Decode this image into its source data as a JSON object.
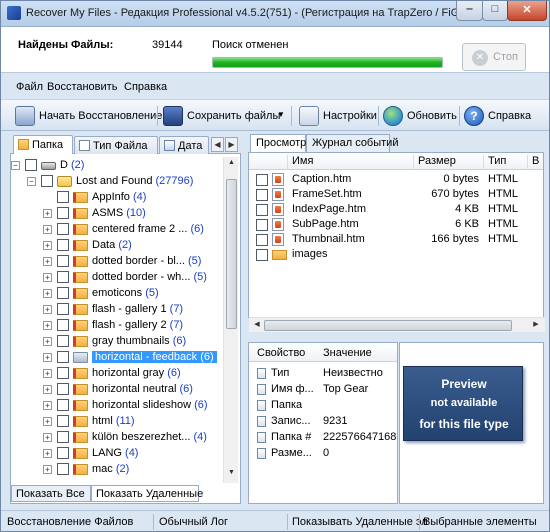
{
  "window": {
    "title": "Recover My Files - Редакция Professional v4.5.2(751)   -  (Регистрация на TrapZero / FiG...",
    "min_label": "‒",
    "max_label": "□",
    "close_label": "✕"
  },
  "status": {
    "found_label": "Найдены Файлы:",
    "found_value": "39144",
    "search_label": "Поиск отменен",
    "progress": 1.0,
    "stop_label": "Стоп"
  },
  "menu": [
    "Файл",
    "Восстановить",
    "Справка"
  ],
  "toolbar": {
    "start_recovery": "Начать Восстановление",
    "save_files": "Сохранить файлы",
    "settings": "Настройки",
    "update": "Обновить",
    "help": "Справка"
  },
  "left_tabs": [
    "Папка",
    "Тип Файла",
    "Дата"
  ],
  "tree": [
    {
      "name": "D",
      "count": "(2)",
      "icon": "drive",
      "level": 0,
      "exp": "−"
    },
    {
      "name": "Lost and Found",
      "count": "(27796)",
      "icon": "lost",
      "level": 1,
      "exp": "−"
    },
    {
      "name": "AppInfo",
      "count": "(4)",
      "icon": "folder-red",
      "level": 2,
      "exp": ""
    },
    {
      "name": "ASMS",
      "count": "(10)",
      "icon": "folder-red",
      "level": 2,
      "exp": "+"
    },
    {
      "name": "centered frame 2 ...",
      "count": "(6)",
      "icon": "folder-red",
      "level": 2,
      "exp": "+"
    },
    {
      "name": "Data",
      "count": "(2)",
      "icon": "folder-red",
      "level": 2,
      "exp": "+"
    },
    {
      "name": "dotted border - bl...",
      "count": "(5)",
      "icon": "folder-red",
      "level": 2,
      "exp": "+"
    },
    {
      "name": "dotted border - wh...",
      "count": "(5)",
      "icon": "folder-red",
      "level": 2,
      "exp": "+"
    },
    {
      "name": "emoticons",
      "count": "(5)",
      "icon": "folder-red",
      "level": 2,
      "exp": "+"
    },
    {
      "name": "flash - gallery 1",
      "count": "(7)",
      "icon": "folder-red",
      "level": 2,
      "exp": "+"
    },
    {
      "name": "flash - gallery 2",
      "count": "(7)",
      "icon": "folder-red",
      "level": 2,
      "exp": "+"
    },
    {
      "name": "gray thumbnails",
      "count": "(6)",
      "icon": "folder-red",
      "level": 2,
      "exp": "+"
    },
    {
      "name": "horizontal - feedback",
      "count": "(6)",
      "icon": "folder-gray",
      "level": 2,
      "exp": "+",
      "selected": true
    },
    {
      "name": "horizontal gray",
      "count": "(6)",
      "icon": "folder-red",
      "level": 2,
      "exp": "+"
    },
    {
      "name": "horizontal neutral",
      "count": "(6)",
      "icon": "folder-red",
      "level": 2,
      "exp": "+"
    },
    {
      "name": "horizontal slideshow",
      "count": "(6)",
      "icon": "folder-red",
      "level": 2,
      "exp": "+"
    },
    {
      "name": "html",
      "count": "(11)",
      "icon": "folder-red",
      "level": 2,
      "exp": "+"
    },
    {
      "name": "külön beszerezhet...",
      "count": "(4)",
      "icon": "folder-red",
      "level": 2,
      "exp": "+"
    },
    {
      "name": "LANG",
      "count": "(4)",
      "icon": "folder-red",
      "level": 2,
      "exp": "+"
    },
    {
      "name": "mac",
      "count": "(2)",
      "icon": "folder-red",
      "level": 2,
      "exp": "+"
    }
  ],
  "bottom_tabs": [
    "Показать Все",
    "Показать Удаленные"
  ],
  "right_tabs": [
    "Просмотр",
    "Журнал событий"
  ],
  "file_columns": [
    "Имя",
    "Размер",
    "Тип",
    "В"
  ],
  "files": [
    {
      "name": "Caption.htm",
      "size": "0 bytes",
      "type": "HTML",
      "icon": "html"
    },
    {
      "name": "FrameSet.htm",
      "size": "670 bytes",
      "type": "HTML",
      "icon": "html"
    },
    {
      "name": "IndexPage.htm",
      "size": "4 KB",
      "type": "HTML",
      "icon": "html"
    },
    {
      "name": "SubPage.htm",
      "size": "6 KB",
      "type": "HTML",
      "icon": "html"
    },
    {
      "name": "Thumbnail.htm",
      "size": "166 bytes",
      "type": "HTML",
      "icon": "html"
    },
    {
      "name": "images",
      "size": "",
      "type": "",
      "icon": "folder"
    }
  ],
  "props_columns": [
    "Свойство",
    "Значение"
  ],
  "props": [
    {
      "k": "Тип",
      "v": "Неизвестно"
    },
    {
      "k": "Имя ф...",
      "v": "Top Gear"
    },
    {
      "k": "Папка",
      "v": ""
    },
    {
      "k": "Запис...",
      "v": "9231"
    },
    {
      "k": "Папка #",
      "v": "222576647168"
    },
    {
      "k": "Разме...",
      "v": "0"
    }
  ],
  "preview": [
    "Preview",
    "not available",
    "for this file type"
  ],
  "statusbar": [
    "Восстановление Файлов",
    "Обычный Лог",
    "Показывать Удаленные эл",
    "Выбранные элементы"
  ]
}
